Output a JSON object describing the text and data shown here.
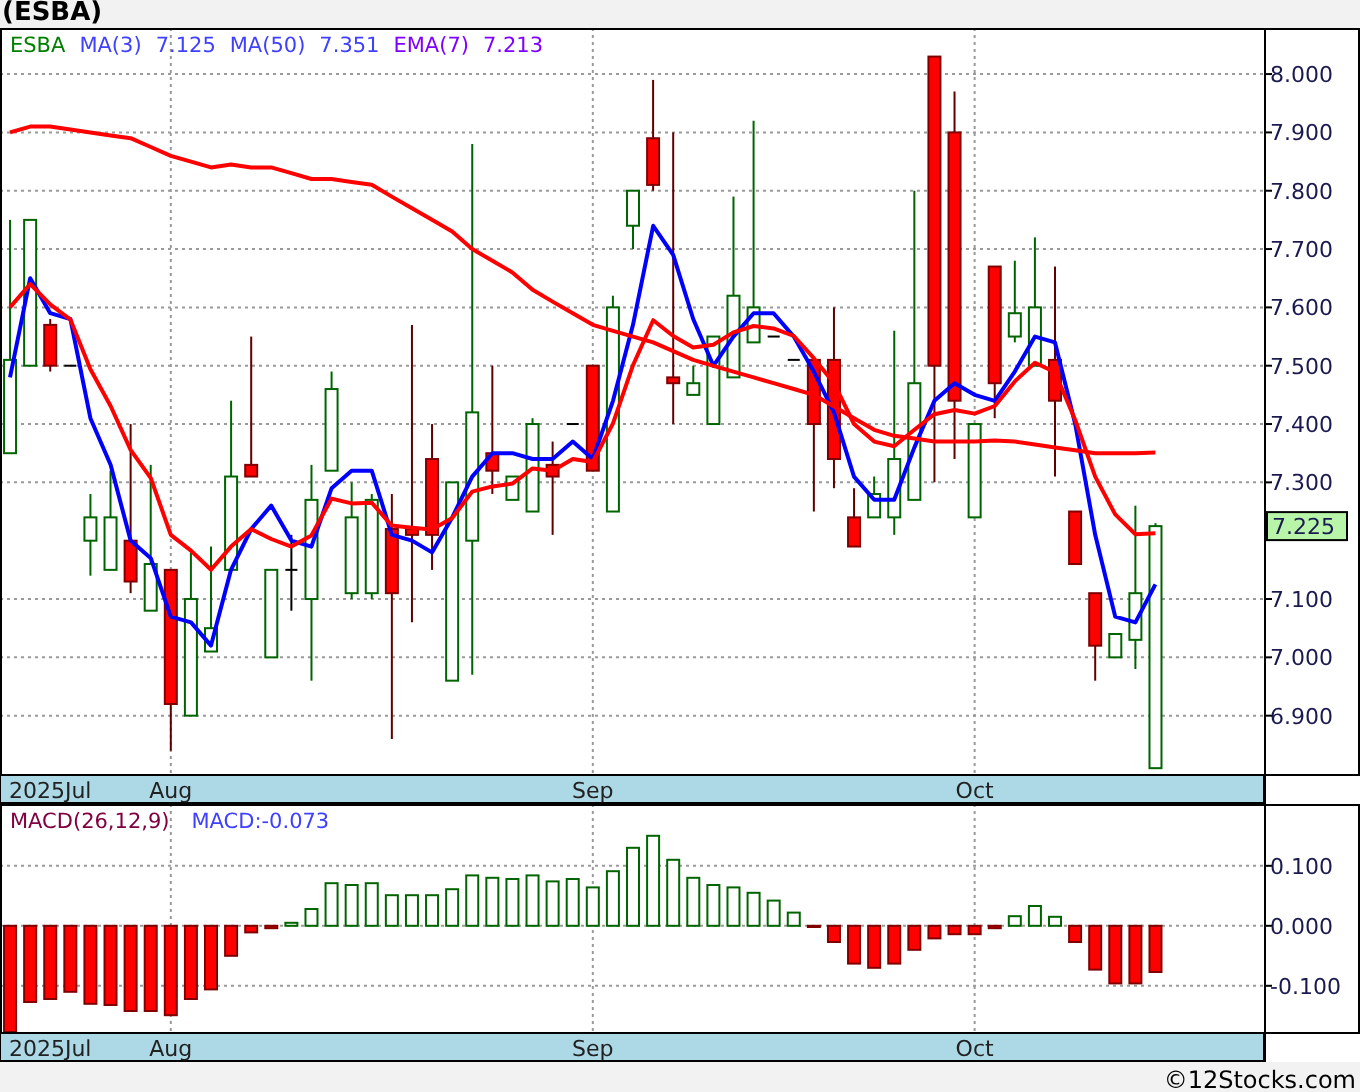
{
  "title": "(ESBA)",
  "price_panel": {
    "legend_values": [
      "7.125",
      "7.351",
      "7.213"
    ],
    "last_price": "7.225",
    "chart_data": {
      "type": "candlestick",
      "title": "ESBA",
      "grid": true,
      "ylim": [
        6.8,
        8.079
      ],
      "categories": [
        null,
        null,
        "2025Jul",
        null,
        null,
        null,
        null,
        null,
        "Aug",
        null,
        null,
        null,
        null,
        null,
        null,
        null,
        null,
        null,
        null,
        null,
        null,
        null,
        null,
        null,
        null,
        null,
        null,
        null,
        null,
        "Sep",
        null,
        null,
        null,
        null,
        null,
        null,
        null,
        null,
        null,
        null,
        null,
        null,
        null,
        null,
        null,
        null,
        null,
        null,
        "Oct",
        null,
        null,
        null,
        null,
        null,
        null,
        null,
        null,
        null
      ],
      "yticks": [
        {
          "value": 8.0,
          "label": "8.000"
        },
        {
          "value": 7.9,
          "label": "7.900"
        },
        {
          "value": 7.8,
          "label": "7.800"
        },
        {
          "value": 7.7,
          "label": "7.700"
        },
        {
          "value": 7.6,
          "label": "7.600"
        },
        {
          "value": 7.5,
          "label": "7.500"
        },
        {
          "value": 7.4,
          "label": "7.400"
        },
        {
          "value": 7.3,
          "label": "7.300"
        },
        {
          "value": 7.1,
          "label": "7.100"
        },
        {
          "value": 7.0,
          "label": "7.000"
        },
        {
          "value": 6.9,
          "label": "6.900"
        }
      ],
      "ohlc": [
        [
          7.35,
          7.75,
          7.35,
          7.51
        ],
        [
          7.5,
          7.75,
          7.5,
          7.75
        ],
        [
          7.57,
          7.58,
          7.49,
          7.5
        ],
        [
          7.5,
          7.5,
          7.5,
          7.5
        ],
        [
          7.2,
          7.28,
          7.14,
          7.24
        ],
        [
          7.15,
          7.32,
          7.15,
          7.24
        ],
        [
          7.2,
          7.4,
          7.11,
          7.13
        ],
        [
          7.08,
          7.33,
          7.08,
          7.16
        ],
        [
          7.15,
          7.15,
          6.84,
          6.92
        ],
        [
          6.9,
          7.18,
          6.9,
          7.1
        ],
        [
          7.01,
          7.19,
          7.01,
          7.05
        ],
        [
          7.15,
          7.44,
          7.15,
          7.31
        ],
        [
          7.33,
          7.55,
          7.31,
          7.31
        ],
        [
          7.0,
          7.15,
          7.0,
          7.15
        ],
        [
          7.15,
          7.21,
          7.08,
          7.15
        ],
        [
          7.1,
          7.33,
          6.96,
          7.27
        ],
        [
          7.32,
          7.49,
          7.32,
          7.46
        ],
        [
          7.11,
          7.3,
          7.1,
          7.24
        ],
        [
          7.11,
          7.28,
          7.1,
          7.27
        ],
        [
          7.22,
          7.28,
          6.86,
          7.11
        ],
        [
          7.22,
          7.57,
          7.06,
          7.21
        ],
        [
          7.34,
          7.4,
          7.15,
          7.21
        ],
        [
          6.96,
          7.3,
          6.96,
          7.3
        ],
        [
          7.2,
          7.88,
          6.97,
          7.42
        ],
        [
          7.35,
          7.5,
          7.28,
          7.32
        ],
        [
          7.27,
          7.31,
          7.27,
          7.31
        ],
        [
          7.25,
          7.41,
          7.25,
          7.4
        ],
        [
          7.33,
          7.37,
          7.21,
          7.31
        ],
        [
          7.4,
          7.4,
          7.4,
          7.4
        ],
        [
          7.5,
          7.5,
          7.32,
          7.32
        ],
        [
          7.25,
          7.62,
          7.25,
          7.6
        ],
        [
          7.74,
          7.8,
          7.7,
          7.8
        ],
        [
          7.89,
          7.99,
          7.8,
          7.81
        ],
        [
          7.48,
          7.9,
          7.4,
          7.47
        ],
        [
          7.45,
          7.5,
          7.45,
          7.47
        ],
        [
          7.4,
          7.55,
          7.4,
          7.55
        ],
        [
          7.48,
          7.79,
          7.48,
          7.62
        ],
        [
          7.54,
          7.92,
          7.54,
          7.6
        ],
        [
          7.55,
          7.55,
          7.55,
          7.55
        ],
        [
          7.51,
          7.51,
          7.51,
          7.51
        ],
        [
          7.51,
          7.51,
          7.25,
          7.4
        ],
        [
          7.51,
          7.6,
          7.29,
          7.34
        ],
        [
          7.24,
          7.29,
          7.19,
          7.19
        ],
        [
          7.24,
          7.31,
          7.24,
          7.28
        ],
        [
          7.24,
          7.56,
          7.21,
          7.34
        ],
        [
          7.27,
          7.8,
          7.27,
          7.47
        ],
        [
          8.03,
          8.03,
          7.3,
          7.5
        ],
        [
          7.9,
          7.97,
          7.34,
          7.44
        ],
        [
          7.24,
          7.4,
          7.24,
          7.4
        ],
        [
          7.67,
          7.67,
          7.41,
          7.47
        ],
        [
          7.55,
          7.68,
          7.54,
          7.59
        ],
        [
          7.5,
          7.72,
          7.5,
          7.6
        ],
        [
          7.51,
          7.67,
          7.31,
          7.44
        ],
        [
          7.25,
          7.25,
          7.16,
          7.16
        ],
        [
          7.11,
          7.11,
          6.96,
          7.02
        ],
        [
          7.0,
          7.04,
          7.0,
          7.04
        ],
        [
          7.03,
          7.26,
          6.98,
          7.11
        ],
        [
          6.81,
          7.23,
          6.81,
          7.225
        ]
      ],
      "series": [
        {
          "name": "MA(3)",
          "type": "line",
          "color": "#0000ff",
          "values": [
            7.48,
            7.65,
            7.59,
            7.58,
            7.41,
            7.33,
            7.2,
            7.17,
            7.07,
            7.06,
            7.02,
            7.15,
            7.22,
            7.26,
            7.2,
            7.19,
            7.29,
            7.32,
            7.32,
            7.21,
            7.2,
            7.18,
            7.24,
            7.31,
            7.35,
            7.35,
            7.34,
            7.34,
            7.37,
            7.34,
            7.44,
            7.57,
            7.74,
            7.69,
            7.58,
            7.5,
            7.55,
            7.59,
            7.59,
            7.55,
            7.49,
            7.42,
            7.31,
            7.27,
            7.27,
            7.36,
            7.44,
            7.47,
            7.45,
            7.44,
            7.49,
            7.55,
            7.54,
            7.4,
            7.21,
            7.07,
            7.06,
            7.125
          ]
        },
        {
          "name": "MA(50)",
          "type": "line",
          "color": "#ff0000",
          "values": [
            7.9,
            7.91,
            7.91,
            7.905,
            7.9,
            7.895,
            7.89,
            7.875,
            7.86,
            7.85,
            7.84,
            7.845,
            7.84,
            7.84,
            7.83,
            7.82,
            7.82,
            7.815,
            7.81,
            7.79,
            7.77,
            7.75,
            7.73,
            7.7,
            7.68,
            7.66,
            7.63,
            7.61,
            7.59,
            7.57,
            7.56,
            7.55,
            7.54,
            7.525,
            7.51,
            7.5,
            7.49,
            7.48,
            7.47,
            7.46,
            7.45,
            7.43,
            7.41,
            7.39,
            7.38,
            7.375,
            7.37,
            7.37,
            7.37,
            7.372,
            7.37,
            7.365,
            7.36,
            7.355,
            7.35,
            7.35,
            7.35,
            7.351
          ]
        },
        {
          "name": "EMA(7)",
          "type": "line",
          "color": "#ff0000",
          "values": [
            7.6,
            7.64,
            7.605,
            7.579,
            7.494,
            7.431,
            7.356,
            7.307,
            7.21,
            7.183,
            7.15,
            7.19,
            7.22,
            7.203,
            7.19,
            7.209,
            7.272,
            7.264,
            7.265,
            7.226,
            7.222,
            7.219,
            7.239,
            7.284,
            7.293,
            7.298,
            7.324,
            7.32,
            7.34,
            7.335,
            7.401,
            7.501,
            7.578,
            7.551,
            7.531,
            7.536,
            7.557,
            7.568,
            7.564,
            7.551,
            7.513,
            7.47,
            7.4,
            7.37,
            7.362,
            7.39,
            7.417,
            7.424,
            7.418,
            7.431,
            7.473,
            7.505,
            7.489,
            7.407,
            7.31,
            7.245,
            7.211,
            7.213
          ]
        }
      ]
    }
  },
  "macd_panel": {
    "legend_values": [
      "-0.073"
    ],
    "chart_data": {
      "type": "bar",
      "stacked": true,
      "grid": true,
      "ylim": [
        -0.177,
        0.203
      ],
      "categories": [
        null,
        null,
        "2025Jul",
        null,
        null,
        null,
        null,
        null,
        "Aug",
        null,
        null,
        null,
        null,
        null,
        null,
        null,
        null,
        null,
        null,
        null,
        null,
        null,
        null,
        null,
        null,
        null,
        null,
        null,
        null,
        "Sep",
        null,
        null,
        null,
        null,
        null,
        null,
        null,
        null,
        null,
        null,
        null,
        null,
        null,
        null,
        null,
        null,
        null,
        null,
        "Oct",
        null,
        null,
        null,
        null,
        null,
        null,
        null,
        null,
        null
      ],
      "yticks": [
        {
          "value": 0.1,
          "label": "0.100"
        },
        {
          "value": 0,
          "label": "0.000"
        },
        {
          "value": -0.1,
          "label": "-0.100"
        }
      ],
      "series": [
        {
          "name": "MACD(26,12,9)",
          "color": "#006400",
          "values": [
            null,
            null,
            null,
            null,
            null,
            null,
            null,
            null,
            null,
            null,
            null,
            null,
            null,
            null,
            0.005,
            0.028,
            0.071,
            0.068,
            0.071,
            0.051,
            0.051,
            0.051,
            0.061,
            0.084,
            0.08,
            0.078,
            0.084,
            0.074,
            0.078,
            0.064,
            0.091,
            0.13,
            0.15,
            0.11,
            0.08,
            0.068,
            0.064,
            0.055,
            0.042,
            0.022,
            null,
            null,
            null,
            null,
            null,
            null,
            null,
            null,
            null,
            null,
            0.016,
            0.033,
            0.015,
            null,
            null,
            null,
            null,
            null
          ]
        },
        {
          "name": "MACD:",
          "color": "#ff0000",
          "values": [
            -0.177,
            -0.127,
            -0.122,
            -0.11,
            -0.13,
            -0.132,
            -0.142,
            -0.142,
            -0.149,
            -0.122,
            -0.106,
            -0.05,
            -0.011,
            -0.004,
            null,
            null,
            null,
            null,
            null,
            null,
            null,
            null,
            null,
            null,
            null,
            null,
            null,
            null,
            null,
            null,
            null,
            null,
            null,
            null,
            null,
            null,
            null,
            null,
            null,
            null,
            -0.002,
            -0.027,
            -0.063,
            -0.07,
            -0.063,
            -0.04,
            -0.021,
            -0.014,
            -0.014,
            -0.004,
            null,
            null,
            null,
            -0.027,
            -0.073,
            -0.096,
            -0.096,
            -0.077
          ]
        }
      ]
    }
  },
  "footer": "©12Stocks.com"
}
